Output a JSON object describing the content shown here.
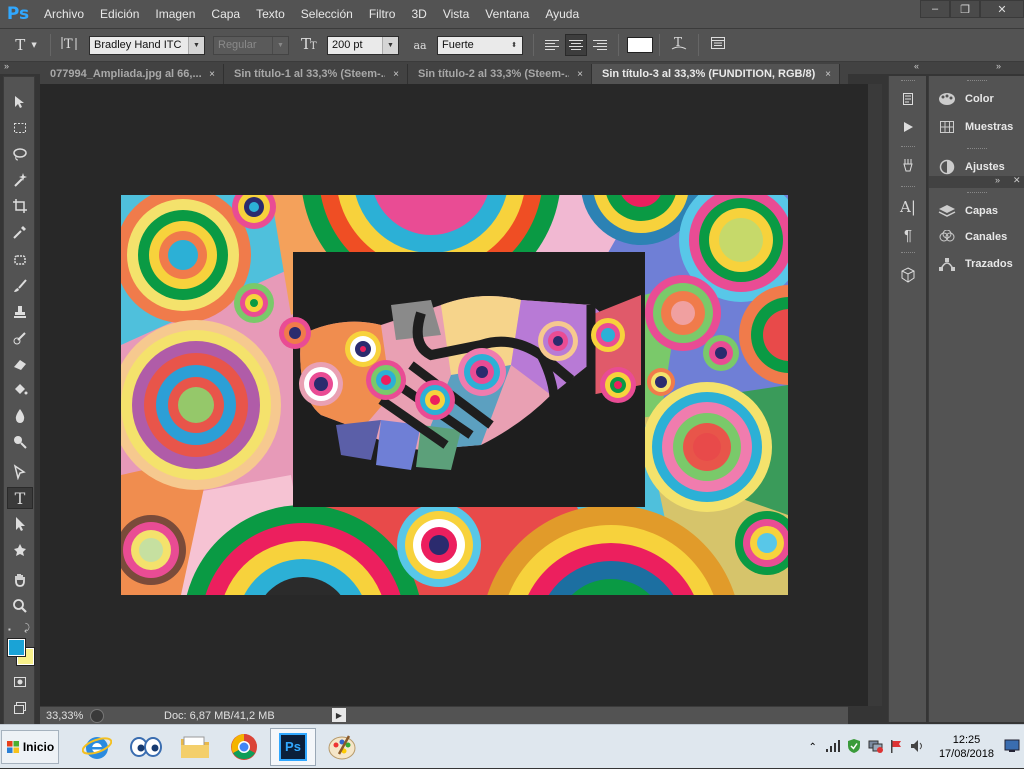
{
  "app": {
    "logo": "Ps"
  },
  "menu": [
    "Archivo",
    "Edición",
    "Imagen",
    "Capa",
    "Texto",
    "Selección",
    "Filtro",
    "3D",
    "Vista",
    "Ventana",
    "Ayuda"
  ],
  "window_controls": {
    "minimize": "–",
    "restore": "❐",
    "close": "✕"
  },
  "options": {
    "tool_glyph": "T",
    "font_family": "Bradley Hand ITC",
    "font_style": "Regular",
    "font_size": "200 pt",
    "antialias_icon": "aa",
    "antialias": "Fuerte",
    "color_swatch": "#ffffff"
  },
  "tabs": [
    {
      "label": "077994_Ampliada.jpg al 66,...",
      "close": "×"
    },
    {
      "label": "Sin título-1 al 33,3% (Steem-...",
      "close": "×"
    },
    {
      "label": "Sin título-2 al 33,3% (Steem-...",
      "close": "×"
    },
    {
      "label": "Sin título-3 al 33,3% (FUNDITION, RGB/8) *",
      "close": "×"
    }
  ],
  "status": {
    "zoom": "33,33%",
    "doc": "Doc: 6,87 MB/41,2 MB"
  },
  "colors": {
    "foreground": "#1aa3d6",
    "background": "#f7f08a",
    "accent": "#31a8ff"
  },
  "panels": {
    "group1": [
      "Color",
      "Muestras"
    ],
    "group2": [
      "Ajustes"
    ],
    "group3": [
      "Capas",
      "Canales",
      "Trazados"
    ]
  },
  "taskbar": {
    "start": "Inicio",
    "apps": [
      "internet-explorer-icon",
      "eyes-icon",
      "folder-icon",
      "chrome-icon",
      "photoshop-icon",
      "paint-icon"
    ],
    "ps_label": "Ps",
    "time": "12:25",
    "date": "17/08/2018"
  }
}
